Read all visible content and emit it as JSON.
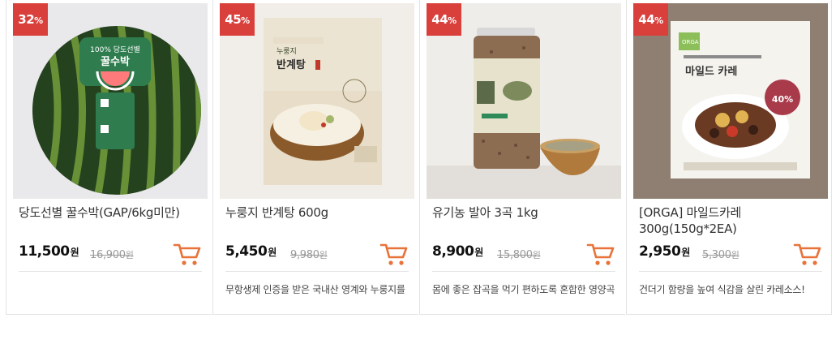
{
  "products": [
    {
      "discount": "32",
      "discount_unit": "%",
      "name": "당도선별 꿀수박(GAP/6kg미만)",
      "price": "11,500",
      "original_price": "16,900",
      "currency": "원",
      "description": "",
      "image_label_1": "100% 당도선별",
      "image_label_2": "꿀수박"
    },
    {
      "discount": "45",
      "discount_unit": "%",
      "name": "누룽지 반계탕 600g",
      "price": "5,450",
      "original_price": "9,980",
      "currency": "원",
      "description": "무항생제 인증을 받은 국내산 영계와 누룽지를",
      "image_label_1": "누룽지",
      "image_label_2": "반계탕"
    },
    {
      "discount": "44",
      "discount_unit": "%",
      "name": "유기농 발아 3곡 1kg",
      "price": "8,900",
      "original_price": "15,800",
      "currency": "원",
      "description": "몸에 좋은 잡곡을 먹기 편하도록 혼합한 영양곡"
    },
    {
      "discount": "44",
      "discount_unit": "%",
      "name": "[ORGA] 마일드카레 300g(150g*2EA)",
      "price": "2,950",
      "original_price": "5,300",
      "currency": "원",
      "description": "건더기 함량을 높여 식감을 살린 카레소스!",
      "image_label_1": "ORGA",
      "image_label_2": "마일드 카레",
      "image_label_3": "40%"
    }
  ],
  "colors": {
    "badge": "#d9403c",
    "cart_icon": "#e8733a"
  }
}
